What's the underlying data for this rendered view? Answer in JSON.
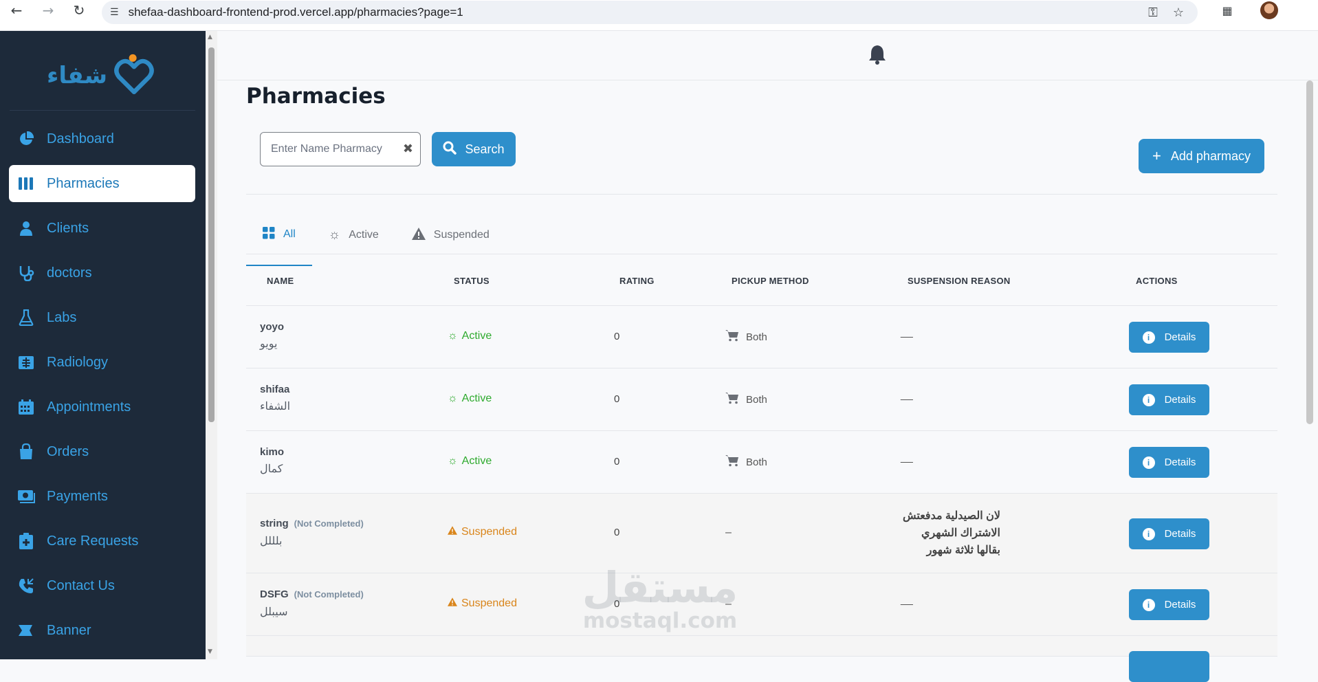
{
  "browser": {
    "url": "shefaa-dashboard-frontend-prod.vercel.app/pharmacies?page=1"
  },
  "brand": {
    "logo_text": "شفاء",
    "accent": "#2e8fcb",
    "sidebar_bg": "#1d2a3a"
  },
  "sidebar": {
    "items": [
      {
        "label": "Dashboard",
        "icon": "pie-chart-icon",
        "active": false
      },
      {
        "label": "Pharmacies",
        "icon": "columns-icon",
        "active": true
      },
      {
        "label": "Clients",
        "icon": "user-icon",
        "active": false
      },
      {
        "label": "doctors",
        "icon": "stethoscope-icon",
        "active": false
      },
      {
        "label": "Labs",
        "icon": "flask-icon",
        "active": false
      },
      {
        "label": "Radiology",
        "icon": "xray-icon",
        "active": false
      },
      {
        "label": "Appointments",
        "icon": "calendar-icon",
        "active": false
      },
      {
        "label": "Orders",
        "icon": "shopping-bag-icon",
        "active": false
      },
      {
        "label": "Payments",
        "icon": "money-icon",
        "active": false
      },
      {
        "label": "Care Requests",
        "icon": "medical-kit-icon",
        "active": false
      },
      {
        "label": "Contact Us",
        "icon": "phone-icon",
        "active": false
      },
      {
        "label": "Banner",
        "icon": "flag-icon",
        "active": false
      }
    ]
  },
  "page": {
    "title": "Pharmacies",
    "search_placeholder": "Enter Name Pharmacy",
    "search_label": "Search",
    "add_label": "Add pharmacy"
  },
  "tabs": [
    {
      "label": "All",
      "icon": "grid-icon",
      "active": true
    },
    {
      "label": "Active",
      "icon": "sun-icon",
      "active": false
    },
    {
      "label": "Suspended",
      "icon": "warning-icon",
      "active": false
    }
  ],
  "table": {
    "headers": {
      "name": "NAME",
      "status": "STATUS",
      "rating": "RATING",
      "pickup": "PICKUP METHOD",
      "reason": "SUSPENSION REASON",
      "actions": "ACTIONS"
    },
    "details_label": "Details",
    "rows": [
      {
        "name_en": "yoyo",
        "name_ar": "يويو",
        "note": "",
        "status": "Active",
        "rating": "0",
        "pickup": "Both",
        "reason": "__"
      },
      {
        "name_en": "shifaa",
        "name_ar": "الشفاء",
        "note": "",
        "status": "Active",
        "rating": "0",
        "pickup": "Both",
        "reason": "__"
      },
      {
        "name_en": "kimo",
        "name_ar": "كمال",
        "note": "",
        "status": "Active",
        "rating": "0",
        "pickup": "Both",
        "reason": "__"
      },
      {
        "name_en": "string",
        "name_ar": "بلللل",
        "note": "(Not Completed)",
        "status": "Suspended",
        "rating": "0",
        "pickup": "–",
        "reason": "لان الصيدلية مدفعتش الاشتراك الشهري بقالها ثلاثة شهور"
      },
      {
        "name_en": "DSFG",
        "name_ar": "سيبلل",
        "note": "(Not Completed)",
        "status": "Suspended",
        "rating": "0",
        "pickup": "–",
        "reason": "__"
      }
    ]
  },
  "watermark": {
    "ar": "مستقل",
    "en": "mostaql.com"
  }
}
